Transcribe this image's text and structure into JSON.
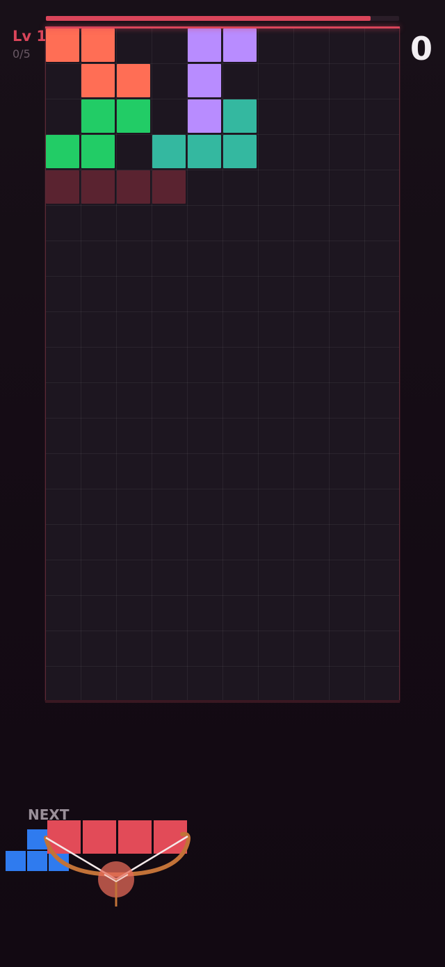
{
  "hud": {
    "level_label": "Lv 1",
    "level_progress": "0/5",
    "score": "0",
    "timer_fraction": 0.92
  },
  "colors": {
    "orange": "#ff6e55",
    "purple": "#b88cff",
    "green": "#22cc66",
    "teal": "#34b8a0",
    "target": "#5a2330",
    "red": "#e24b58",
    "blue": "#2f7bef",
    "bow": "#c27238"
  },
  "board": {
    "columns": 10,
    "rows": 19,
    "cells": [
      {
        "row": 0,
        "col": 0,
        "color": "orange"
      },
      {
        "row": 0,
        "col": 1,
        "color": "orange"
      },
      {
        "row": 1,
        "col": 1,
        "color": "orange"
      },
      {
        "row": 1,
        "col": 2,
        "color": "orange"
      },
      {
        "row": 0,
        "col": 4,
        "color": "purple"
      },
      {
        "row": 0,
        "col": 5,
        "color": "purple"
      },
      {
        "row": 1,
        "col": 4,
        "color": "purple"
      },
      {
        "row": 2,
        "col": 4,
        "color": "purple"
      },
      {
        "row": 2,
        "col": 1,
        "color": "green"
      },
      {
        "row": 2,
        "col": 2,
        "color": "green"
      },
      {
        "row": 3,
        "col": 0,
        "color": "green"
      },
      {
        "row": 3,
        "col": 1,
        "color": "green"
      },
      {
        "row": 2,
        "col": 5,
        "color": "teal"
      },
      {
        "row": 3,
        "col": 3,
        "color": "teal"
      },
      {
        "row": 3,
        "col": 4,
        "color": "teal"
      },
      {
        "row": 3,
        "col": 5,
        "color": "teal"
      },
      {
        "row": 4,
        "col": 0,
        "color": "target"
      },
      {
        "row": 4,
        "col": 1,
        "color": "target"
      },
      {
        "row": 4,
        "col": 2,
        "color": "target"
      },
      {
        "row": 4,
        "col": 3,
        "color": "target"
      }
    ]
  },
  "next": {
    "label": "NEXT",
    "shape": "T",
    "color": "blue"
  },
  "launcher": {
    "loaded_piece": "I",
    "loaded_color": "red"
  }
}
